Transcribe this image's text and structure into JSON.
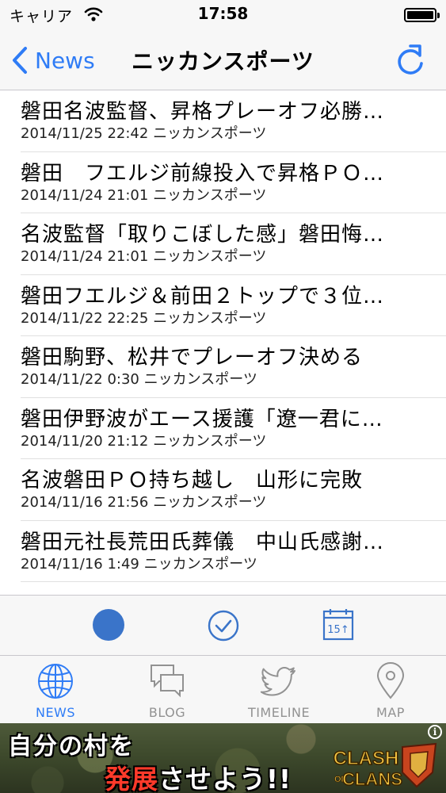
{
  "status_bar": {
    "carrier": "キャリア",
    "time": "17:58"
  },
  "nav": {
    "back_label": "News",
    "title": "ニッカンスポーツ"
  },
  "articles": [
    {
      "headline": "磐田名波監督、昇格プレーオフ必勝…",
      "meta": "2014/11/25 22:42 ニッカンスポーツ"
    },
    {
      "headline": "磐田　フエルジ前線投入で昇格ＰＯ…",
      "meta": "2014/11/24 21:01 ニッカンスポーツ"
    },
    {
      "headline": "名波監督「取りこぼした感」磐田悔…",
      "meta": "2014/11/24 21:01 ニッカンスポーツ"
    },
    {
      "headline": "磐田フエルジ＆前田２トップで３位…",
      "meta": "2014/11/22 22:25 ニッカンスポーツ"
    },
    {
      "headline": "磐田駒野、松井でプレーオフ決める",
      "meta": "2014/11/22 0:30 ニッカンスポーツ"
    },
    {
      "headline": "磐田伊野波がエース援護「遼一君に…",
      "meta": "2014/11/20 21:12 ニッカンスポーツ"
    },
    {
      "headline": "名波磐田ＰＯ持ち越し　山形に完敗",
      "meta": "2014/11/16 21:56 ニッカンスポーツ"
    },
    {
      "headline": "磐田元社長荒田氏葬儀　中山氏感謝…",
      "meta": "2014/11/16 1:49 ニッカンスポーツ"
    }
  ],
  "action_bar": {
    "calendar_text": "15↑"
  },
  "tabs": [
    {
      "label": "NEWS",
      "icon": "globe-icon",
      "active": true
    },
    {
      "label": "BLOG",
      "icon": "chat-bubbles-icon",
      "active": false
    },
    {
      "label": "TIMELINE",
      "icon": "bird-icon",
      "active": false
    },
    {
      "label": "MAP",
      "icon": "map-pin-icon",
      "active": false
    }
  ],
  "ad": {
    "line1": "自分の村を",
    "line2_red": "発展",
    "line2_rest": "させよう!!",
    "logo_top": "CLASH",
    "logo_of": "OF",
    "logo_bottom": "CLANS",
    "info": "i"
  },
  "colors": {
    "accent": "#2f7cf6",
    "action_circle": "#3a74c9",
    "inactive_tab": "#929292"
  }
}
